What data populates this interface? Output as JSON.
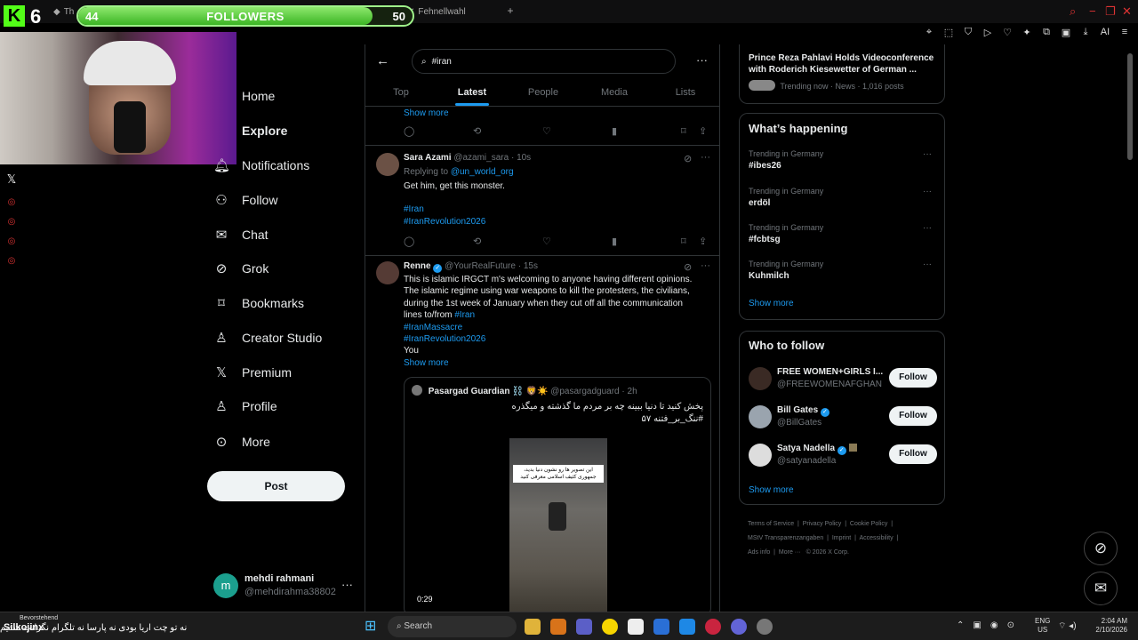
{
  "browser": {
    "tabs": [
      "Th",
      "Fehnellwahl"
    ],
    "window_controls": [
      "search-icon",
      "minimize-icon",
      "restore-icon",
      "close-icon"
    ]
  },
  "overlay": {
    "followers_current": "44",
    "followers_label": "FOLLOWERS",
    "followers_goal": "50",
    "followers_fraction": 0.88,
    "kick_number": "6",
    "stream_name": "Silkojinx",
    "upcoming_label": "Bevorstehend",
    "caption_text": "نه تو چت اریا بودی نه پارسا نه تلگرام نگرانت شدیم",
    "side_icons": [
      "x-icon",
      "red-dot",
      "red-dot",
      "red-dot",
      "red-dot"
    ]
  },
  "sidebar": {
    "items": [
      {
        "label": "Home",
        "icon": "home-icon"
      },
      {
        "label": "Explore",
        "icon": "search-icon"
      },
      {
        "label": "Notifications",
        "icon": "bell-icon"
      },
      {
        "label": "Follow",
        "icon": "person-plus-icon"
      },
      {
        "label": "Chat",
        "icon": "mail-icon"
      },
      {
        "label": "Grok",
        "icon": "grok-icon"
      },
      {
        "label": "Bookmarks",
        "icon": "bookmark-icon"
      },
      {
        "label": "Creator Studio",
        "icon": "creator-icon"
      },
      {
        "label": "Premium",
        "icon": "x-icon"
      },
      {
        "label": "Profile",
        "icon": "person-icon"
      },
      {
        "label": "More",
        "icon": "more-circle-icon"
      }
    ],
    "post_label": "Post",
    "account": {
      "initial": "m",
      "name": "mehdi rahmani",
      "handle": "@mehdirahma38802"
    }
  },
  "search": {
    "query": "#iran",
    "tabs": [
      "Top",
      "Latest",
      "People",
      "Media",
      "Lists"
    ],
    "active_tab": "Latest"
  },
  "feed": {
    "prev_show_more": "Show more",
    "tweets": [
      {
        "name": "Sara Azami",
        "handle": "@azami_sara",
        "time": "10s",
        "replying_prefix": "Replying to",
        "replying_to": "@un_world_org",
        "text": "Get him, get this monster.",
        "tags": [
          "#Iran",
          "#IranRevolution2026"
        ]
      },
      {
        "name": "Renne",
        "handle": "@YourRealFuture",
        "time": "15s",
        "lines": [
          "This is islamic IRGCT m's welcoming to anyone having different opinions.",
          "The islamic regime using war weapons to kill the protesters, the civilians,",
          "during the 1st week of January when they cut off all the communication"
        ],
        "line4_prefix": "lines to/from",
        "line4_tag": "#Iran",
        "tags": [
          "#IranMassacre",
          "#IranRevolution2026"
        ],
        "tail": "You",
        "show_more": "Show more",
        "quote": {
          "name": "Pasargad Guardian",
          "emoji": "⛓️",
          "flag": "🦁☀️",
          "handle": "@pasargadguard",
          "time": "2h",
          "text_line1": "پخش کنید تا دنیا ببینه چه بر مردم ما گذشته و میگذره",
          "text_line2": "#ننگ_بر_فتنه ۵۷",
          "video_caption": "این تصویر ها رو نشون دنیا بدید، جمهوری کثیف اسلامی معرفی کنید",
          "video_time": "0:29"
        }
      }
    ]
  },
  "right": {
    "top_story": {
      "title": "Prince Reza Pahlavi Holds Videoconference with Roderich Kiesewetter of German ...",
      "meta": "Trending now · News · 1,016 posts"
    },
    "happening_title": "What’s happening",
    "trends": [
      {
        "context": "Trending in Germany",
        "name": "#ibes26"
      },
      {
        "context": "Trending in Germany",
        "name": "erdöl"
      },
      {
        "context": "Trending in Germany",
        "name": "#fcbtsg"
      },
      {
        "context": "Trending in Germany",
        "name": "Kuhmilch"
      }
    ],
    "show_more": "Show more",
    "who_to_follow_title": "Who to follow",
    "who_to_follow": [
      {
        "name": "FREE WOMEN+GIRLS I...",
        "handle": "@FREEWOMENAFGHAN",
        "button": "Follow",
        "verified": false
      },
      {
        "name": "Bill Gates",
        "handle": "@BillGates",
        "button": "Follow",
        "verified": true
      },
      {
        "name": "Satya Nadella",
        "handle": "@satyanadella",
        "button": "Follow",
        "verified": true
      }
    ],
    "wtf_show_more": "Show more",
    "footer_links": [
      "Terms of Service",
      "Privacy Policy",
      "Cookie Policy",
      "MStV Transparenzangaben",
      "Imprint",
      "Accessibility",
      "Ads info",
      "More ···",
      "© 2026 X Corp."
    ]
  },
  "taskbar": {
    "search_label": "Search",
    "lang_top": "ENG",
    "lang_bottom": "US",
    "time": "2:04 AM",
    "date": "2/10/2026"
  },
  "colors": {
    "accent": "#1d9bf0",
    "kick_green": "#53fc18",
    "background": "#000000"
  }
}
